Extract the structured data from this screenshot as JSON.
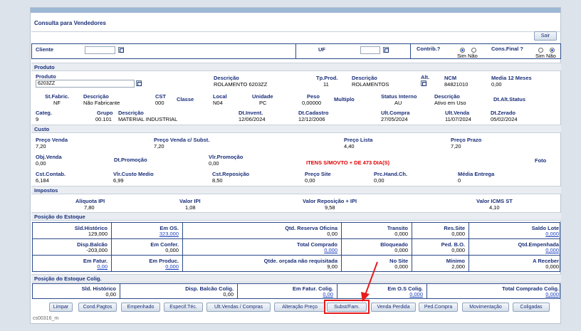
{
  "title": "Consulta para Vendedores",
  "buttons": {
    "sair": "Sair"
  },
  "cliente": {
    "label": "Cliente",
    "uf": "UF",
    "contrib": "Contrib.?",
    "cons_final": "Cons.Final ?",
    "sim": "Sim",
    "nao": "Não"
  },
  "sections": {
    "produto": "Produto",
    "custo": "Custo",
    "impostos": "Impostos",
    "estoque": "Posição do Estoque",
    "estoque_colig": "Posição do Estoque Colig."
  },
  "produto": {
    "produto_label": "Produto",
    "produto_value": "6203ZZ",
    "descricao_label": "Descrição",
    "descricao_value": "ROLAMENTO 6203ZZ",
    "tpprod_label": "Tp.Prod.",
    "tpprod_value": "11",
    "descricao2_label": "Descrição",
    "descricao2_value": "ROLAMENTOS",
    "alt_label": "Alt.",
    "ncm_label": "NCM",
    "ncm_value": "84821010",
    "media12_label": "Media 12 Meses",
    "media12_value": "0,00",
    "stfabric_label": "St.Fabric.",
    "stfabric_value": "NF",
    "descfab_label": "Descrição",
    "descfab_value": "Não Fabricante",
    "cst_label": "CST",
    "cst_value": "000",
    "classe_label": "Classe",
    "local_label": "Local",
    "local_value": "N04",
    "unidade_label": "Unidade",
    "unidade_value": "PC",
    "peso_label": "Peso",
    "peso_value": "0,00000",
    "multiplo_label": "Multiplo",
    "status_label": "Status Interno",
    "status_value": "AU",
    "descstatus_label": "Descrição",
    "descstatus_value": "Ativo em Uso",
    "dtalt_label": "Dt.Alt.Status",
    "categ_label": "Categ.",
    "categ_value": "9",
    "grupo_label": "Grupo",
    "grupo_value": "00.101",
    "descgrupo_label": "Descrição",
    "descgrupo_value": "MATERIAL INDUSTRIAL",
    "dtinvent_label": "Dt.Invent.",
    "dtinvent_value": "12/06/2024",
    "dtcad_label": "Dt.Cadastro",
    "dtcad_value": "12/12/2006",
    "ultcompra_label": "Ult.Compra",
    "ultcompra_value": "27/05/2024",
    "ultvenda_label": "Ult.Venda",
    "ultvenda_value": "11/07/2024",
    "dtzerado_label": "Dt.Zerado",
    "dtzerado_value": "05/02/2024"
  },
  "custo": {
    "pvenda_label": "Preço Venda",
    "pvenda_value": "7,20",
    "pvsubst_label": "Preço Venda c/ Subst.",
    "pvsubst_value": "7,20",
    "plista_label": "Preço Lista",
    "plista_value": "4,40",
    "pprazo_label": "Preço Prazo",
    "pprazo_value": "7,20",
    "objvenda_label": "Obj.Venda",
    "objvenda_value": "0,00",
    "dtpromo_label": "Dt.Promoção",
    "vlpromo_label": "Vlr.Promoção",
    "vlpromo_value": "0,00",
    "alert": "ITENS S/MOVTO + DE 473 DIA(S)",
    "foto_label": "Foto",
    "cstcontab_label": "Cst.Contab.",
    "cstcontab_value": "6,184",
    "vlcusto_label": "Vlr.Custo Medio",
    "vlcusto_value": "6,99",
    "cstrepos_label": "Cst.Reposição",
    "cstrepos_value": "8,50",
    "psite_label": "Preço Site",
    "psite_value": "0,00",
    "prchand_label": "Prc.Hand.Ch.",
    "prchand_value": "0,00",
    "mediaent_label": "Média Entrega",
    "mediaent_value": "0"
  },
  "impostos": {
    "aliq_label": "Alíquota IPI",
    "aliq_value": "7,80",
    "vlipi_label": "Valor IPI",
    "vlipi_value": "1,08",
    "vlrepos_label": "Valor Reposição + IPI",
    "vlrepos_value": "9,58",
    "icms_label": "Valor ICMS ST",
    "icms_value": "4,10"
  },
  "estoque": {
    "r1": [
      [
        "Sld.Histórico",
        "129,000"
      ],
      [
        "Em OS.",
        "323,000"
      ],
      [
        "Qtd. Reserva Oficina",
        "0,00"
      ],
      [
        "Transito",
        "0,000"
      ],
      [
        "Res.Site",
        "0,000"
      ],
      [
        "Saldo Lote",
        "0,000"
      ]
    ],
    "r2": [
      [
        "Disp.Balcão",
        "-203,000"
      ],
      [
        "Em Confer.",
        "0,000"
      ],
      [
        "Total Comprado",
        "0,000"
      ],
      [
        "Bloqueado",
        "0,000"
      ],
      [
        "Ped. B.O.",
        "0,000"
      ],
      [
        "Qtd.Empenhada",
        "0,000"
      ]
    ],
    "r3": [
      [
        "Em Fatur.",
        "0,00"
      ],
      [
        "Em Produc.",
        "0,000"
      ],
      [
        "Qtde. orçada não requisitada",
        "9,00"
      ],
      [
        "No Site",
        "0,000"
      ],
      [
        "Mínimo",
        "2,000"
      ],
      [
        "A Receber",
        "0,000"
      ]
    ]
  },
  "colig": [
    [
      "Sld. Histórico",
      "0,00"
    ],
    [
      "Disp. Balcão Colig.",
      "0,00"
    ],
    [
      "Em Fatur. Colig.",
      "0,00"
    ],
    [
      "Em O.S Colig.",
      "0,000"
    ],
    [
      "Total Comprado Colig.",
      "0,000"
    ]
  ],
  "toolbar": [
    "Limpar",
    "Cond.Pagtos",
    "Empenhado",
    "Especif.Téc.",
    "Ult.Vendas / Compras",
    "Alteração Preço",
    "Subst/Fam.",
    "Venda Perdida",
    "Ped.Compra",
    "Movimentação",
    "Coligadas"
  ],
  "footer": "cs00316_m"
}
